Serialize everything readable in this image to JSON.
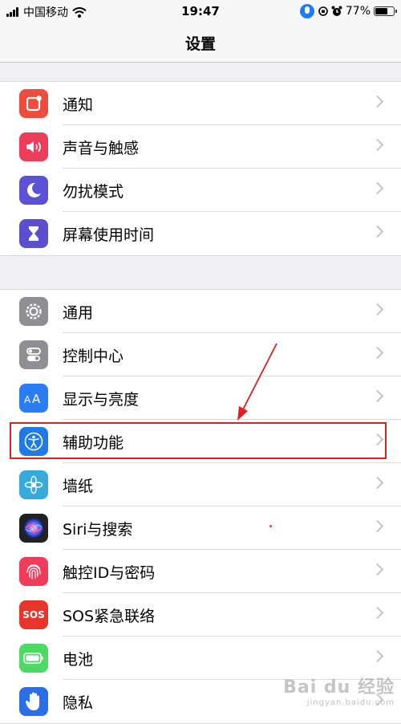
{
  "status_bar": {
    "carrier": "中国移动",
    "time": "19:47",
    "battery_percent": "77%",
    "battery_level": 0.77
  },
  "nav": {
    "title": "设置"
  },
  "groups": [
    {
      "rows": [
        {
          "label": "通知",
          "icon": "notification-icon",
          "color": "#ee4c3d"
        },
        {
          "label": "声音与触感",
          "icon": "speaker-icon",
          "color": "#ee3d5a"
        },
        {
          "label": "勿扰模式",
          "icon": "moon-icon",
          "color": "#5b52d6"
        },
        {
          "label": "屏幕使用时间",
          "icon": "hourglass-icon",
          "color": "#5b4ecf"
        }
      ]
    },
    {
      "rows": [
        {
          "label": "通用",
          "icon": "gear-icon",
          "color": "#8e8e93"
        },
        {
          "label": "控制中心",
          "icon": "toggles-icon",
          "color": "#8e8e93"
        },
        {
          "label": "显示与亮度",
          "icon": "text-size-icon",
          "color": "#2a7cf2"
        },
        {
          "label": "辅助功能",
          "icon": "accessibility-icon",
          "color": "#1f7ae8"
        },
        {
          "label": "墙纸",
          "icon": "flower-icon",
          "color": "#37aadc"
        },
        {
          "label": "Siri与搜索",
          "icon": "siri-icon",
          "color": "#222222"
        },
        {
          "label": "触控ID与密码",
          "icon": "fingerprint-icon",
          "color": "#ee3d5a"
        },
        {
          "label": "SOS紧急联络",
          "icon": "sos-icon",
          "color": "#e8352b",
          "icon_text": "SOS"
        },
        {
          "label": "电池",
          "icon": "battery-icon",
          "color": "#4cd964"
        },
        {
          "label": "隐私",
          "icon": "hand-icon",
          "color": "#2a6fe8"
        }
      ]
    }
  ],
  "watermark": {
    "text": "Bai du 经验",
    "sub": "jingyan.baidu.com"
  },
  "colors": {
    "highlight": "#e02020",
    "arrow": "#e02020"
  }
}
